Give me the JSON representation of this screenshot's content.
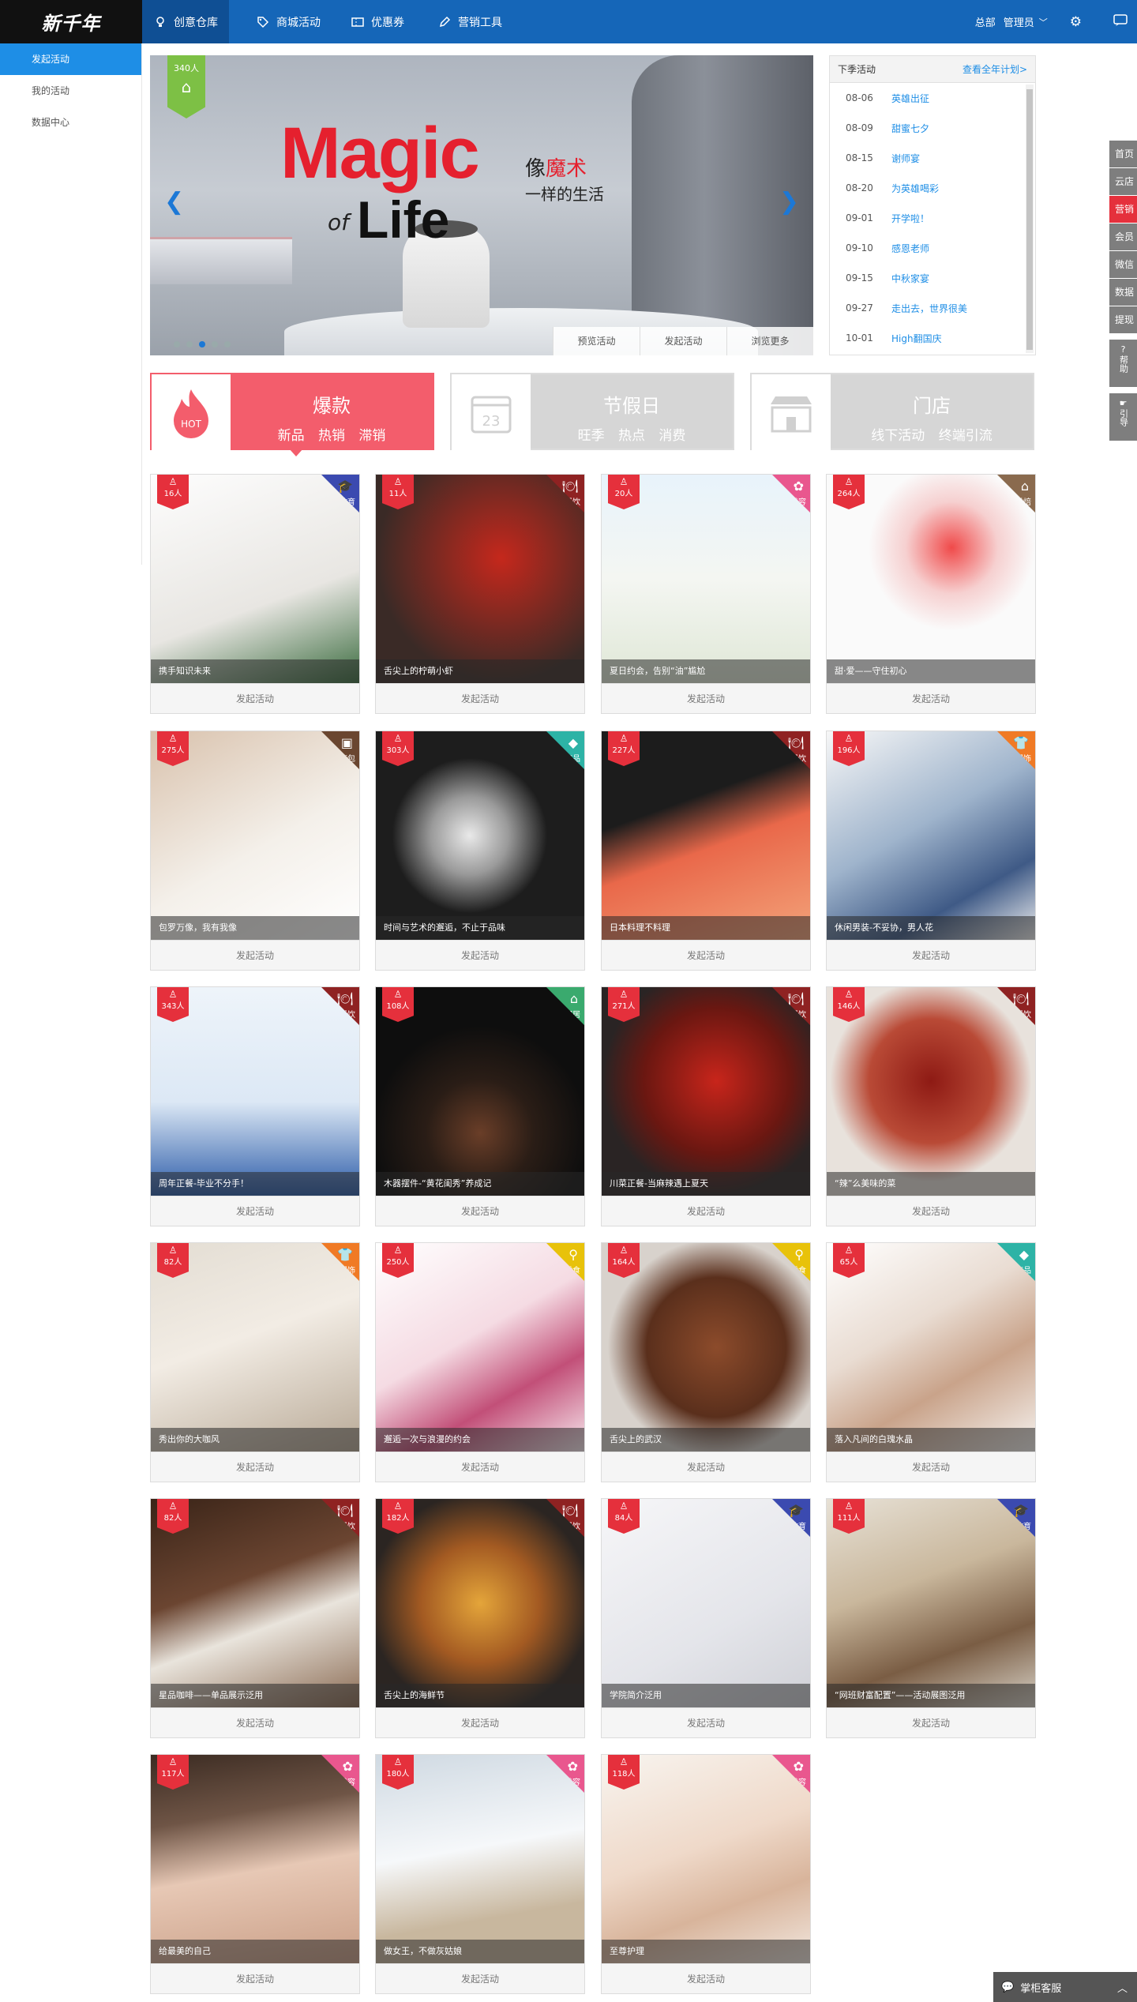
{
  "logo": {
    "text": "新千年"
  },
  "topnav": [
    {
      "label": "创意仓库",
      "icon": "bulb-icon"
    },
    {
      "label": "商城活动",
      "icon": "tag-icon"
    },
    {
      "label": "优惠券",
      "icon": "ticket-icon"
    },
    {
      "label": "营销工具",
      "icon": "pen-icon"
    }
  ],
  "topright": {
    "store": "总部",
    "user": "管理员"
  },
  "sidebar": [
    {
      "label": "发起活动"
    },
    {
      "label": "我的活动"
    },
    {
      "label": "数据中心"
    }
  ],
  "banner": {
    "count": "340人",
    "title_magic": "Magic",
    "title_of": "of",
    "title_life": "Life",
    "cn_line1_a": "像",
    "cn_line1_b": "魔术",
    "cn_line2": "一样的生活",
    "buttons": [
      "预览活动",
      "发起活动",
      "浏览更多"
    ]
  },
  "schedule": {
    "title": "下季活动",
    "more": "查看全年计划>",
    "items": [
      {
        "date": "08-06",
        "title": "英雄出征"
      },
      {
        "date": "08-09",
        "title": "甜蜜七夕"
      },
      {
        "date": "08-15",
        "title": "谢师宴"
      },
      {
        "date": "08-20",
        "title": "为英雄喝彩"
      },
      {
        "date": "09-01",
        "title": "开学啦！"
      },
      {
        "date": "09-10",
        "title": "感恩老师"
      },
      {
        "date": "09-15",
        "title": "中秋家宴"
      },
      {
        "date": "09-27",
        "title": "走出去，世界很美"
      },
      {
        "date": "10-01",
        "title": "High翻国庆"
      }
    ]
  },
  "categories": [
    {
      "title": "爆款",
      "sub": "新品 热销 滞销",
      "icon_text": "HOT"
    },
    {
      "title": "节假日",
      "sub": "旺季 热点 消费",
      "icon_text": "23"
    },
    {
      "title": "门店",
      "sub": "线下活动 终端引流",
      "icon_text": ""
    }
  ],
  "cards": [
    {
      "count": "16人",
      "tag": "教育",
      "tag_icon": "graduation-cap-icon",
      "tag_color": "#3b4ab0",
      "caption": "携手知识未来",
      "bg": "linear-gradient(160deg,#fdfdfd,#e8e6e2 60%,#3a6b3e)",
      "action": "发起活动"
    },
    {
      "count": "11人",
      "tag": "餐饮",
      "tag_icon": "dish-icon",
      "tag_color": "#8f2222",
      "caption": "舌尖上的柠萌小虾",
      "bg": "radial-gradient(circle at 60% 40%,#c5281c,#3a2a26 70%)",
      "action": "发起活动"
    },
    {
      "count": "20人",
      "tag": "美容",
      "tag_icon": "beauty-icon",
      "tag_color": "#e9578e",
      "caption": "夏日约会，告别“油”尴尬",
      "bg": "linear-gradient(180deg,#e8f3fb,#f4f6f2 50%,#dfe7d6)",
      "action": "发起活动"
    },
    {
      "count": "264人",
      "tag": "烘焙",
      "tag_icon": "cake-icon",
      "tag_color": "#8a6a4e",
      "caption": "甜·爱——守住初心",
      "bg": "radial-gradient(circle at 60% 35%,#f04a4a 0,#f6d0d0 25%,#fafafa 45%)",
      "action": "发起活动"
    },
    {
      "count": "275人",
      "tag": "箱包",
      "tag_icon": "bag-icon",
      "tag_color": "#6a4630",
      "caption": "包罗万像，我有我像",
      "bg": "linear-gradient(150deg,#d9c2ad,#f4f0ea 55%,#ffffff)",
      "action": "发起活动"
    },
    {
      "count": "303人",
      "tag": "饰品",
      "tag_icon": "diamond-icon",
      "tag_color": "#2db3a6",
      "caption": "时间与艺术的邂逅，不止于品味",
      "bg": "radial-gradient(circle at 45% 50%,#e9e9e9 0,#9a9a9a 25%,#1d1d1d 50%)",
      "action": "发起活动"
    },
    {
      "count": "227人",
      "tag": "餐饮",
      "tag_icon": "dish-icon",
      "tag_color": "#8f2222",
      "caption": "日本料理不料理",
      "bg": "linear-gradient(160deg,#1c1c1c 35%,#e9684a 55%,#f3a37a)",
      "action": "发起活动"
    },
    {
      "count": "196人",
      "tag": "服饰",
      "tag_icon": "shirt-icon",
      "tag_color": "#f07a25",
      "caption": "休闲男装-不妥协，男人花",
      "bg": "linear-gradient(150deg,#f7f7f7,#9fb4cc 45%,#3f5a86 75%,#f2f2f2)",
      "action": "发起活动"
    },
    {
      "count": "343人",
      "tag": "餐饮",
      "tag_icon": "dish-icon",
      "tag_color": "#8f2222",
      "caption": "周年正餐-毕业不分手！",
      "bg": "linear-gradient(180deg,#eef4fa,#dce8f5 55%,#2b5ba8)",
      "action": "发起活动"
    },
    {
      "count": "108人",
      "tag": "家居",
      "tag_icon": "house-icon",
      "tag_color": "#3aaa6e",
      "caption": "木器摆件-“黄花闺秀”养成记",
      "bg": "radial-gradient(circle at 50% 70%,#6a3e28 0,#2a1d16 30%,#0e0e0e 60%)",
      "action": "发起活动"
    },
    {
      "count": "271人",
      "tag": "餐饮",
      "tag_icon": "dish-icon",
      "tag_color": "#8f2222",
      "caption": "川菜正餐-当麻辣遇上夏天",
      "bg": "radial-gradient(circle at 55% 45%,#c8251b,#6a1711 45%,#2a2424 70%)",
      "action": "发起活动"
    },
    {
      "count": "146人",
      "tag": "餐饮",
      "tag_icon": "dish-icon",
      "tag_color": "#8f2222",
      "caption": "“辣”么美味的菜",
      "bg": "radial-gradient(circle at 50% 45%,#8e1a14,#b94a36 40%,#e8e2dc 65%)",
      "action": "发起活动"
    },
    {
      "count": "82人",
      "tag": "服饰",
      "tag_icon": "shirt-icon",
      "tag_color": "#f07a25",
      "caption": "秀出你的大咖风",
      "bg": "linear-gradient(160deg,#e3ddd3,#f2ece4 45%,#b8a996)",
      "action": "发起活动"
    },
    {
      "count": "250人",
      "tag": "零食",
      "tag_icon": "search-icon",
      "tag_color": "#e8c20a",
      "caption": "邂逅一次与浪漫的约会",
      "bg": "linear-gradient(150deg,#ffffff,#f5dbe3 45%,#c24f78 70%,#f7e9ee)",
      "action": "发起活动"
    },
    {
      "count": "164人",
      "tag": "零食",
      "tag_icon": "search-icon",
      "tag_color": "#e8c20a",
      "caption": "舌尖上的武汉",
      "bg": "radial-gradient(circle at 55% 50%,#8c4b2b,#5a2f1c 45%,#d8d2cc 70%)",
      "action": "发起活动"
    },
    {
      "count": "65人",
      "tag": "饰品",
      "tag_icon": "diamond-icon",
      "tag_color": "#2db3a6",
      "caption": "落入凡间的白瑰水晶",
      "bg": "linear-gradient(150deg,#ffffff,#e9dcd2 40%,#c9a38a 65%,#f6f3f0)",
      "action": "发起活动"
    },
    {
      "count": "82人",
      "tag": "餐饮",
      "tag_icon": "dish-icon",
      "tag_color": "#8f2222",
      "caption": "星品咖啡——单品展示泛用",
      "bg": "linear-gradient(160deg,#3a2418,#6b4531 40%,#e9e4dc 60%,#8a6a52)",
      "action": "发起活动"
    },
    {
      "count": "182人",
      "tag": "餐饮",
      "tag_icon": "dish-icon",
      "tag_color": "#8f2222",
      "caption": "舌尖上的海鲜节",
      "bg": "radial-gradient(circle at 50% 50%,#e4a53a,#a35a22 40%,#2b2522 75%)",
      "action": "发起活动"
    },
    {
      "count": "84人",
      "tag": "教育",
      "tag_icon": "graduation-cap-icon",
      "tag_color": "#3b4ab0",
      "caption": "学院简介泛用",
      "bg": "linear-gradient(150deg,#f6f6f8,#e4e5ea 60%,#cfd0d6)",
      "action": "发起活动"
    },
    {
      "count": "111人",
      "tag": "教育",
      "tag_icon": "graduation-cap-icon",
      "tag_color": "#3b4ab0",
      "caption": "“网班财富配置”——活动展图泛用",
      "bg": "linear-gradient(160deg,#e7e1d6,#c9b79c 40%,#7a5d44 70%,#d9d3c8)",
      "action": "发起活动"
    },
    {
      "count": "117人",
      "tag": "美容",
      "tag_icon": "beauty-icon",
      "tag_color": "#e9578e",
      "caption": "给最美的自己",
      "bg": "linear-gradient(170deg,#3b2b22,#6f5546 30%,#e7c8b5 55%,#c99e86)",
      "action": "发起活动"
    },
    {
      "count": "180人",
      "tag": "美容",
      "tag_icon": "beauty-icon",
      "tag_color": "#e9578e",
      "caption": "做女王，不做灰姑娘",
      "bg": "linear-gradient(170deg,#cfd9e2,#f6f8fa 45%,#c8b79e 75%)",
      "action": "发起活动"
    },
    {
      "count": "118人",
      "tag": "美容",
      "tag_icon": "beauty-icon",
      "tag_color": "#e9578e",
      "caption": "至尊护理",
      "bg": "linear-gradient(160deg,#f8f4ef,#efd9c9 45%,#d8b49b 70%,#f2e8e0)",
      "action": "发起活动"
    }
  ],
  "right_tools": [
    "首页",
    "云店",
    "营销",
    "会员",
    "微信",
    "数据",
    "提现"
  ],
  "right_tools2": [
    "帮助",
    "引导"
  ],
  "kefu": {
    "label": "掌柜客服"
  }
}
